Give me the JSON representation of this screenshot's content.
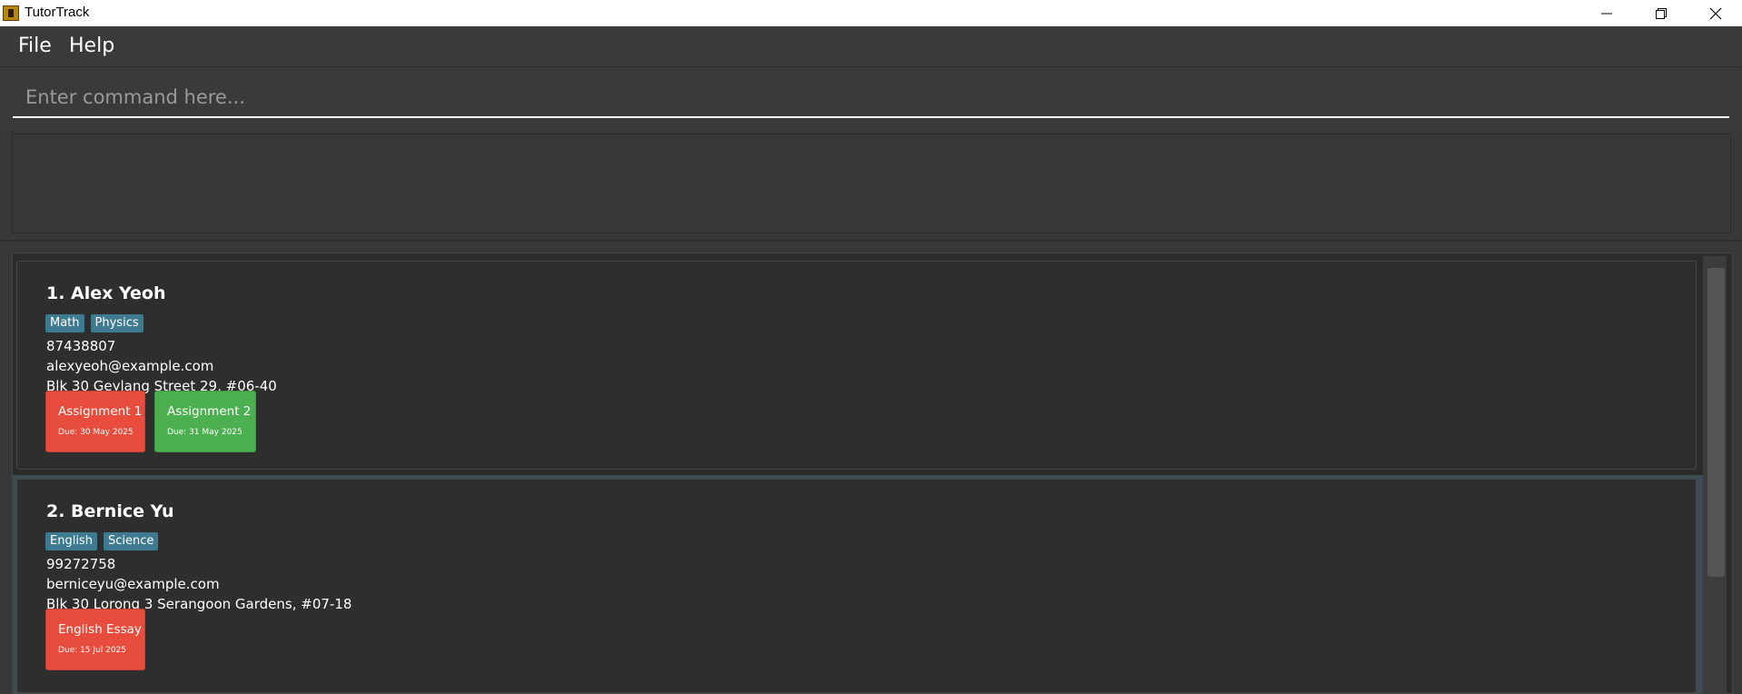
{
  "window": {
    "title": "TutorTrack",
    "icon": "app-icon"
  },
  "menu": {
    "file": "File",
    "help": "Help"
  },
  "command": {
    "placeholder": "Enter command here...",
    "value": ""
  },
  "result": {
    "text": ""
  },
  "persons": [
    {
      "name": "1. Alex Yeoh",
      "tags": [
        "Math",
        "Physics"
      ],
      "phone": "87438807",
      "email": "alexyeoh@example.com",
      "address": "Blk 30 Geylang Street 29, #06-40",
      "assignments": [
        {
          "title": "Assignment 1",
          "due": "Due: 30 May 2025",
          "color": "#e74c3c"
        },
        {
          "title": "Assignment 2",
          "due": "Due: 31 May 2025",
          "color": "#4caf50"
        }
      ]
    },
    {
      "name": "2. Bernice Yu",
      "tags": [
        "English",
        "Science"
      ],
      "phone": "99272758",
      "email": "berniceyu@example.com",
      "address": "Blk 30 Lorong 3 Serangoon Gardens, #07-18",
      "assignments": [
        {
          "title": "English Essay",
          "due": "Due: 15 Jul 2025",
          "color": "#e74c3c"
        }
      ]
    }
  ],
  "colors": {
    "background": "#383838",
    "card": "#2e2e2e",
    "tag": "#3e7b91",
    "overdue": "#e74c3c",
    "done": "#4caf50",
    "selected_border": "#3e4b52"
  }
}
